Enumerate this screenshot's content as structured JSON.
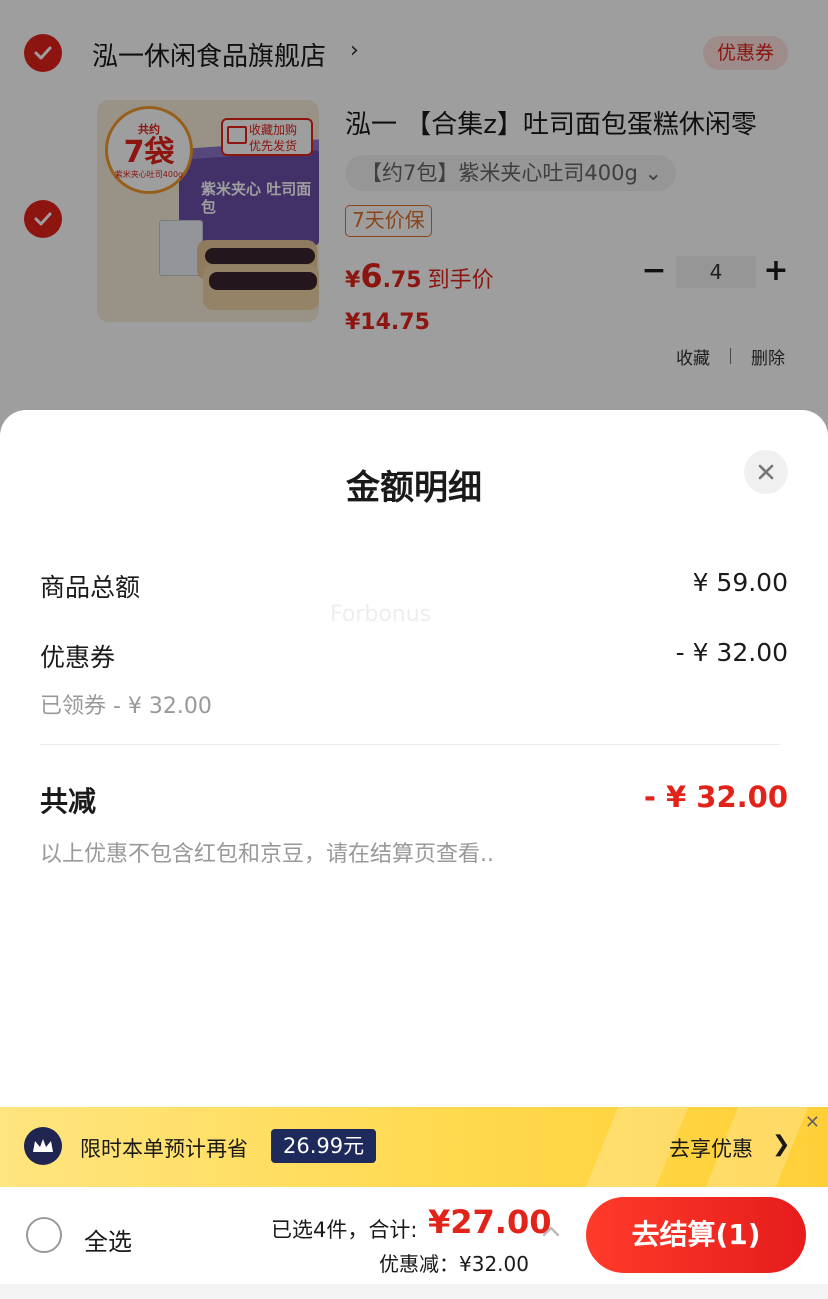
{
  "cart": {
    "shop_name": "泓一休闲食品旗舰店",
    "shop_chevron": "›",
    "coupon_tag": "优惠券",
    "product": {
      "title": "泓一 【合集z】吐司面包蛋糕休闲零",
      "variant": "【约7包】紫米夹心吐司400g ⌄",
      "guarantee": "7天价保",
      "price_currency": "¥",
      "price_int": "6",
      "price_dec": ".75",
      "price_label": "到手价",
      "original_price": "¥14.75",
      "quantity": "4",
      "qty_minus": "−",
      "qty_plus": "+",
      "thumb": {
        "count_top": "共约",
        "count_big": "7袋",
        "count_sub": "紫米夹心吐司400g",
        "promo": "收藏加购 优先发货",
        "box_label": "紫米夹心 吐司面包"
      }
    },
    "favorite": "收藏",
    "delete": "删除"
  },
  "sheet": {
    "title": "金额明细",
    "rows": [
      {
        "label": "商品总额",
        "value": "¥ 59.00"
      },
      {
        "label": "优惠券",
        "value": "- ¥ 32.00"
      }
    ],
    "coupon_note": "已领券 - ¥ 32.00",
    "total_label": "共减",
    "total_value": "- ¥ 32.00",
    "footnote": "以上优惠不包含红包和京豆，请在结算页查看..",
    "watermark": "Forbonus"
  },
  "promo": {
    "text": "限时本单预计再省",
    "badge": "26.99元",
    "cta": "去享优惠",
    "cta_chevron": "❯",
    "close": "✕"
  },
  "bottom": {
    "select_all": "全选",
    "selected_count": "已选4件，合计:",
    "total": "¥27.00",
    "discount": "优惠减：¥32.00",
    "checkout": "去结算(1)"
  },
  "colors": {
    "accent": "#e2231a",
    "promo_bg": "#ffd84a",
    "badge_bg": "#1f2a5c"
  }
}
